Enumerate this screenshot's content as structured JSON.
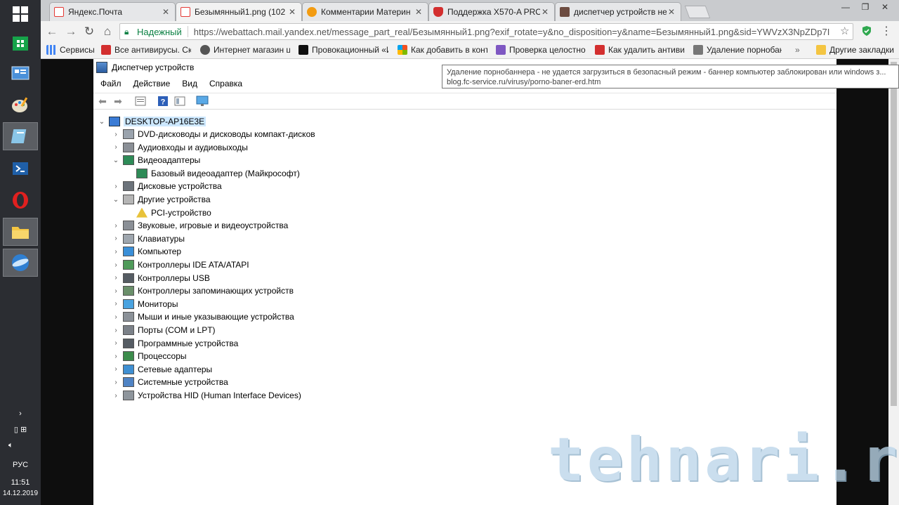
{
  "taskbar": {
    "items": [
      {
        "name": "start-button",
        "icon": "windows-logo-icon"
      },
      {
        "name": "store",
        "icon": "store-icon"
      },
      {
        "name": "control-panel",
        "icon": "control-panel-icon"
      },
      {
        "name": "paint",
        "icon": "paint-palette-icon"
      },
      {
        "name": "app",
        "icon": "app-icon"
      },
      {
        "name": "powershell",
        "icon": "powershell-icon"
      },
      {
        "name": "opera",
        "icon": "opera-icon"
      },
      {
        "name": "explorer",
        "icon": "folder-icon"
      },
      {
        "name": "browser",
        "icon": "browser-icon"
      }
    ],
    "lang": "РУС",
    "time": "11:51",
    "date": "14.12.2019"
  },
  "browser": {
    "tabs": [
      {
        "label": "Яндекс.Почта",
        "color": "#e53935"
      },
      {
        "label": "Безымянный1.png (102",
        "color": "#e53935"
      },
      {
        "label": "Комментарии Материн",
        "color": "#f39c12"
      },
      {
        "label": "Поддержка X570-A PRO",
        "color": "#d32f2f"
      },
      {
        "label": "диспетчер устройств не",
        "color": "#6d4c41"
      }
    ],
    "secure_label": "Надежный",
    "url": "https://webattach.mail.yandex.net/message_part_real/Безымянный1.png?exif_rotate=y&no_disposition=y&name=Безымянный1.png&sid=YWVzX3NpZDp7I",
    "bookmarks": [
      {
        "label": "Сервисы",
        "color": "#4285f4"
      },
      {
        "label": "Все антивирусы. Ска",
        "color": "#d32f2f"
      },
      {
        "label": "Интернет магазин ц",
        "color": "#555555"
      },
      {
        "label": "Провокационный «И",
        "color": "#111111"
      },
      {
        "label": "Как добавить в конте",
        "color": "#f4b400"
      },
      {
        "label": "Проверка целостнос",
        "color": "#7e57c2"
      },
      {
        "label": "Как удалить антивир",
        "color": "#d32f2f"
      },
      {
        "label": "Удаление порнобан",
        "color": "#777777"
      }
    ],
    "more": "»",
    "other_bookmarks": "Другие закладки"
  },
  "device_manager": {
    "title": "Диспетчер устройств",
    "menu": [
      "Файл",
      "Действие",
      "Вид",
      "Справка"
    ],
    "root": "DESKTOP-AP16E3E",
    "tree": [
      {
        "label": "DVD-дисководы и дисководы компакт-дисков",
        "level": 1,
        "exp": "closed",
        "icon": "dvd-drive-icon"
      },
      {
        "label": "Аудиовходы и аудиовыходы",
        "level": 1,
        "exp": "closed",
        "icon": "speaker-icon"
      },
      {
        "label": "Видеоадаптеры",
        "level": 1,
        "exp": "open",
        "icon": "display-adapter-icon"
      },
      {
        "label": "Базовый видеоадаптер (Майкрософт)",
        "level": 2,
        "exp": "none",
        "icon": "display-adapter-icon"
      },
      {
        "label": "Дисковые устройства",
        "level": 1,
        "exp": "closed",
        "icon": "disk-drive-icon"
      },
      {
        "label": "Другие устройства",
        "level": 1,
        "exp": "open",
        "icon": "unknown-device-icon"
      },
      {
        "label": "PCI-устройство",
        "level": 2,
        "exp": "none",
        "icon": "warning-device-icon"
      },
      {
        "label": "Звуковые, игровые и видеоустройства",
        "level": 1,
        "exp": "closed",
        "icon": "speaker-icon"
      },
      {
        "label": "Клавиатуры",
        "level": 1,
        "exp": "closed",
        "icon": "keyboard-icon"
      },
      {
        "label": "Компьютер",
        "level": 1,
        "exp": "closed",
        "icon": "computer-icon"
      },
      {
        "label": "Контроллеры IDE ATA/ATAPI",
        "level": 1,
        "exp": "closed",
        "icon": "ide-controller-icon"
      },
      {
        "label": "Контроллеры USB",
        "level": 1,
        "exp": "closed",
        "icon": "usb-icon"
      },
      {
        "label": "Контроллеры запоминающих устройств",
        "level": 1,
        "exp": "closed",
        "icon": "storage-controller-icon"
      },
      {
        "label": "Мониторы",
        "level": 1,
        "exp": "closed",
        "icon": "monitor-icon"
      },
      {
        "label": "Мыши и иные указывающие устройства",
        "level": 1,
        "exp": "closed",
        "icon": "mouse-icon"
      },
      {
        "label": "Порты (COM и LPT)",
        "level": 1,
        "exp": "closed",
        "icon": "port-icon"
      },
      {
        "label": "Программные устройства",
        "level": 1,
        "exp": "closed",
        "icon": "software-device-icon"
      },
      {
        "label": "Процессоры",
        "level": 1,
        "exp": "closed",
        "icon": "processor-icon"
      },
      {
        "label": "Сетевые адаптеры",
        "level": 1,
        "exp": "closed",
        "icon": "network-adapter-icon"
      },
      {
        "label": "Системные устройства",
        "level": 1,
        "exp": "closed",
        "icon": "system-device-icon"
      },
      {
        "label": "Устройства HID (Human Interface Devices)",
        "level": 1,
        "exp": "closed",
        "icon": "hid-icon"
      }
    ]
  },
  "tooltip": {
    "line1": "Удаление порнобаннера - не удается загрузиться в безопасный режим - баннер компьютер заблокирован или windows з...",
    "line2": "blog.fc-service.ru/virusy/porno-baner-erd.htm"
  },
  "watermark": "tehnari.ru"
}
